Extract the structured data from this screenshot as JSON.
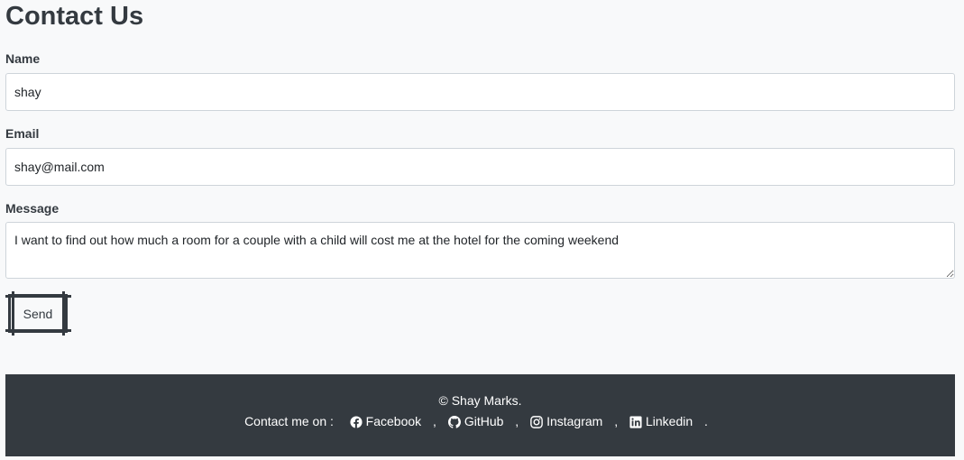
{
  "page": {
    "title": "Contact Us"
  },
  "form": {
    "name_label": "Name",
    "name_value": "shay",
    "email_label": "Email",
    "email_value": "shay@mail.com",
    "message_label": "Message",
    "message_value": "I want to find out how much a room for a couple with a child will cost me at the hotel for the coming weekend",
    "send_label": "Send"
  },
  "footer": {
    "copyright": "© Shay Marks.",
    "contact_prefix": "Contact me on :",
    "separator": ",",
    "end_mark": ".",
    "links": [
      {
        "label": "Facebook",
        "icon": "facebook-icon"
      },
      {
        "label": "GitHub",
        "icon": "github-icon"
      },
      {
        "label": "Instagram",
        "icon": "instagram-icon"
      },
      {
        "label": "Linkedin",
        "icon": "linkedin-icon"
      }
    ]
  },
  "colors": {
    "background": "#f8f9fa",
    "text": "#343a40",
    "footer_bg": "#343a40",
    "footer_text": "#ffffff",
    "input_border": "#ced4da"
  }
}
